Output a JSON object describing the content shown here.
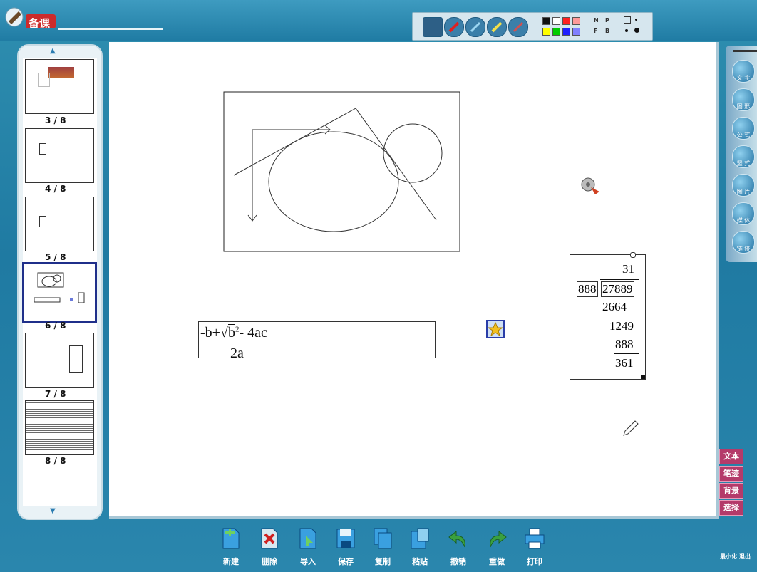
{
  "app": {
    "title": "备课"
  },
  "slides": [
    {
      "label": "3 / 8",
      "selected": false
    },
    {
      "label": "4 / 8",
      "selected": false
    },
    {
      "label": "5 / 8",
      "selected": false
    },
    {
      "label": "6 / 8",
      "selected": true
    },
    {
      "label": "7 / 8",
      "selected": false
    },
    {
      "label": "8 / 8",
      "selected": false
    }
  ],
  "top_toolbar": {
    "tools": [
      "select-tool-icon",
      "pen-red-icon",
      "pen-blue-icon",
      "pen-yellow-icon",
      "brush-icon"
    ],
    "colors": [
      "#111111",
      "#ffffff",
      "#ff2020",
      "#ff9a9a",
      "#ffff00",
      "#00cc00",
      "#2020ff",
      "#8080ff"
    ],
    "shape_labels": [
      "N",
      "P",
      "F",
      "B"
    ]
  },
  "right_tools": [
    {
      "label": "文 字",
      "icon": "text-icon"
    },
    {
      "label": "图 形",
      "icon": "shape-icon"
    },
    {
      "label": "公 式",
      "icon": "formula-icon"
    },
    {
      "label": "竖 式",
      "icon": "vertical-calc-icon"
    },
    {
      "label": "图 片",
      "icon": "picture-icon"
    },
    {
      "label": "媒 体",
      "icon": "media-icon"
    },
    {
      "label": "链 接",
      "icon": "link-icon"
    }
  ],
  "right_modes": [
    "文本",
    "笔迹",
    "背景",
    "选择"
  ],
  "bottom_toolbar": [
    {
      "label": "新建",
      "icon": "new-icon",
      "color": "#3aa0e0"
    },
    {
      "label": "删除",
      "icon": "delete-icon",
      "color": "#d8e8f0"
    },
    {
      "label": "导入",
      "icon": "import-icon",
      "color": "#3aa0e0"
    },
    {
      "label": "保存",
      "icon": "save-icon",
      "color": "#3aa0e0"
    },
    {
      "label": "复制",
      "icon": "copy-icon",
      "color": "#3aa0e0"
    },
    {
      "label": "粘贴",
      "icon": "paste-icon",
      "color": "#3aa0e0"
    },
    {
      "label": "撤销",
      "icon": "undo-icon",
      "color": "#3aa040"
    },
    {
      "label": "重做",
      "icon": "redo-icon",
      "color": "#3aa040"
    },
    {
      "label": "打印",
      "icon": "print-icon",
      "color": "#3aa0e0"
    }
  ],
  "window_controls": {
    "minimize": "最小化",
    "exit": "退出"
  },
  "canvas": {
    "formula": {
      "numerator_left": "-b+",
      "radicand": "b",
      "exp": "2",
      "rest": "- 4ac",
      "denominator": "2a"
    },
    "division": {
      "quotient": "31",
      "divisor": "888",
      "dividend": "27889",
      "step1": "2664",
      "step2": "1249",
      "step3": "888",
      "remainder": "361"
    }
  }
}
